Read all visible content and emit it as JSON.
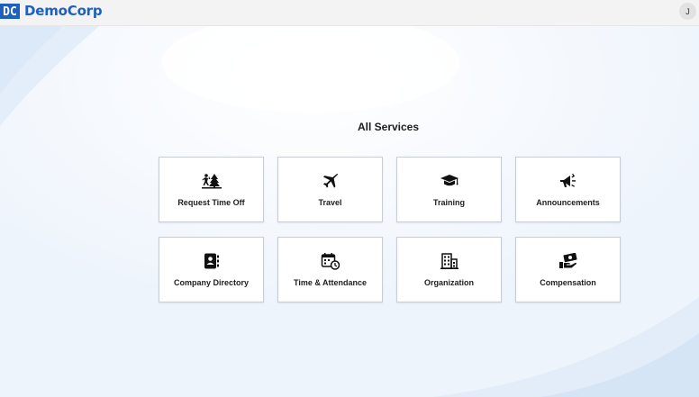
{
  "header": {
    "logo_mark": "DC",
    "brand": "DemoCorp",
    "avatar_initial": "J"
  },
  "main": {
    "title": "All Services",
    "services": [
      {
        "label": "Request Time Off",
        "icon": "hiking-trees-icon"
      },
      {
        "label": "Travel",
        "icon": "airplane-icon"
      },
      {
        "label": "Training",
        "icon": "graduation-cap-icon"
      },
      {
        "label": "Announcements",
        "icon": "megaphone-icon"
      },
      {
        "label": "Company Directory",
        "icon": "address-book-icon"
      },
      {
        "label": "Time & Attendance",
        "icon": "calendar-clock-icon"
      },
      {
        "label": "Organization",
        "icon": "office-building-icon"
      },
      {
        "label": "Compensation",
        "icon": "hand-money-icon"
      }
    ]
  },
  "colors": {
    "brand": "#1f5fbf",
    "background": "#f4f8fd",
    "card_border": "#c9ced6"
  }
}
